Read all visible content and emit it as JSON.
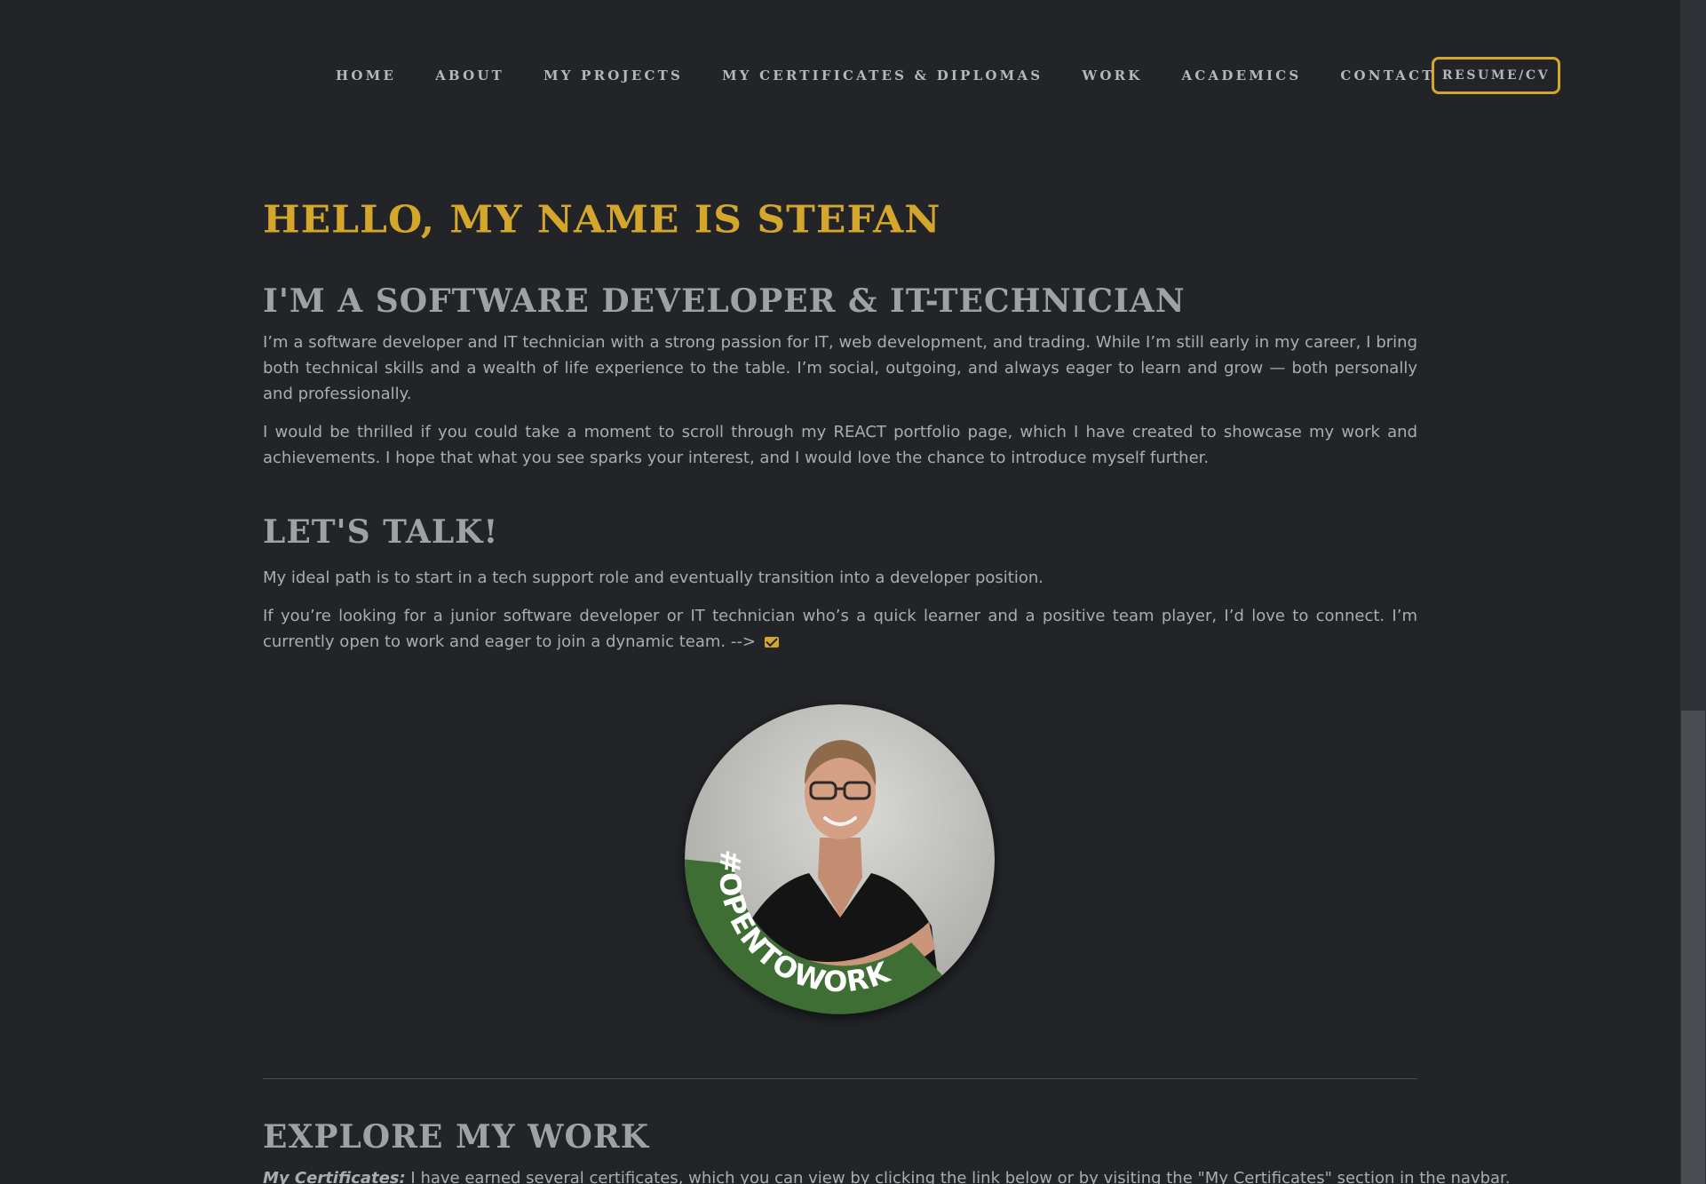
{
  "nav": {
    "links": [
      "HOME",
      "ABOUT",
      "MY PROJECTS",
      "MY CERTIFICATES & DIPLOMAS",
      "WORK",
      "ACADEMICS",
      "CONTACT"
    ],
    "resume_label": "RESUME/CV"
  },
  "hero": {
    "hello": "HELLO, MY NAME IS STEFAN",
    "subtitle": "I'M A SOFTWARE DEVELOPER & IT-TECHNICIAN",
    "para1": "I’m a software developer and IT technician with a strong passion for IT, web development, and trading. While I’m still early in my career, I bring both technical skills and a wealth of life experience to the table. I’m social, outgoing, and always eager to learn and grow — both personally and professionally.",
    "para2": "I would be thrilled if you could take a moment to scroll through my REACT portfolio page, which I have created to showcase my work and achievements. I hope that what you see sparks your interest, and I would love the chance to introduce myself further."
  },
  "talk": {
    "title": "LET'S TALK!",
    "para1": "My ideal path is to start in a tech support role and eventually transition into a developer position.",
    "para2": "If you’re looking for a junior software developer or IT technician who’s a quick learner and a positive team player, I’d love to connect. I’m currently open to work and eager to join a dynamic team. -->"
  },
  "avatar": {
    "badge": "#OPENTOWORK",
    "ring_color": "#3f6e35"
  },
  "explore": {
    "title": "EXPLORE MY WORK",
    "label": "My Certificates:",
    "text": " I have earned several certificates, which you can view by clicking the link below or by visiting the \"My Certificates\" section in the navbar."
  },
  "colors": {
    "background": "#222428",
    "accent": "#d4a72c",
    "heading": "#9ea1a6",
    "text": "#a9adb3"
  },
  "icons": {
    "contact": "envelope-icon"
  }
}
